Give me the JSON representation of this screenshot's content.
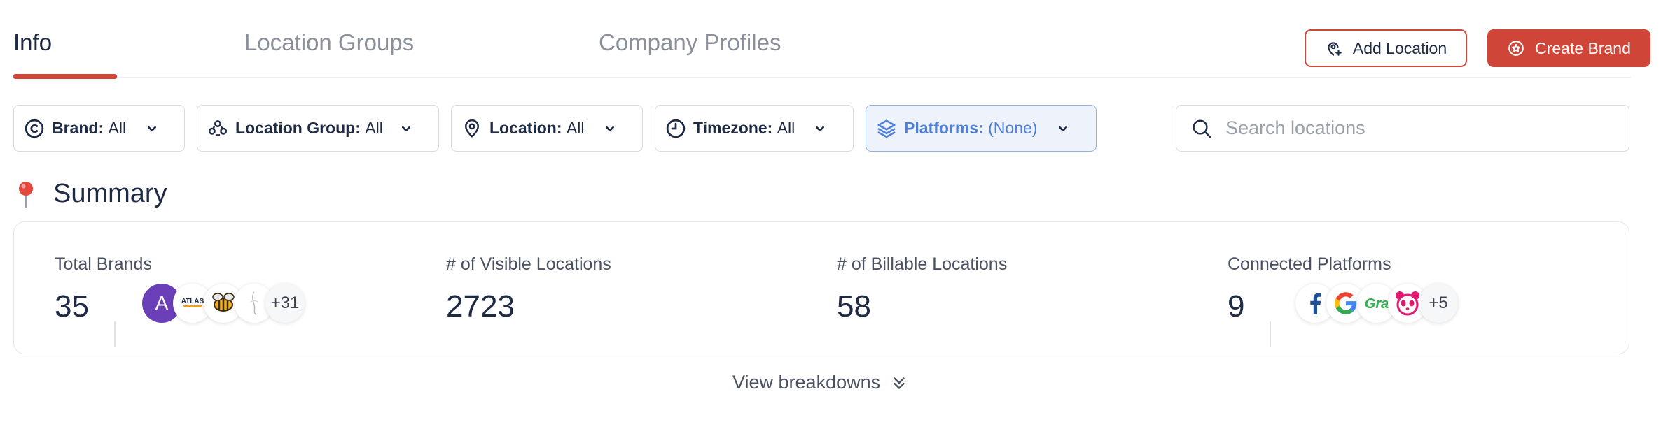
{
  "tabs": [
    {
      "label": "Info",
      "active": true
    },
    {
      "label": "Location Groups",
      "active": false
    },
    {
      "label": "Company Profiles",
      "active": false
    }
  ],
  "actions": {
    "add_location": "Add Location",
    "create_brand": "Create Brand"
  },
  "filters": {
    "brand": {
      "label": "Brand:",
      "value": "All"
    },
    "location_group": {
      "label": "Location Group:",
      "value": "All"
    },
    "location": {
      "label": "Location:",
      "value": "All"
    },
    "timezone": {
      "label": "Timezone:",
      "value": "All"
    },
    "platforms": {
      "label": "Platforms:",
      "value": "(None)"
    }
  },
  "search": {
    "placeholder": "Search locations",
    "value": ""
  },
  "summary": {
    "title": "Summary",
    "stats": {
      "total_brands": {
        "label": "Total Brands",
        "value": "35"
      },
      "visible_locations": {
        "label": "# of Visible Locations",
        "value": "2723"
      },
      "billable_locations": {
        "label": "# of Billable Locations",
        "value": "58"
      },
      "connected_platforms": {
        "label": "Connected Platforms",
        "value": "9"
      }
    },
    "brand_avatars": {
      "letter": "A",
      "logo_text": "ATLAS",
      "more": "+31"
    },
    "platform_avatars": {
      "more": "+5"
    },
    "view_breakdowns": "View breakdowns"
  },
  "colors": {
    "accent": "#cf4638",
    "text": "#1f2a44",
    "muted": "#8a8f99",
    "platforms_active": "#4f7ed6",
    "avatar_purple": "#6a3fb8"
  }
}
